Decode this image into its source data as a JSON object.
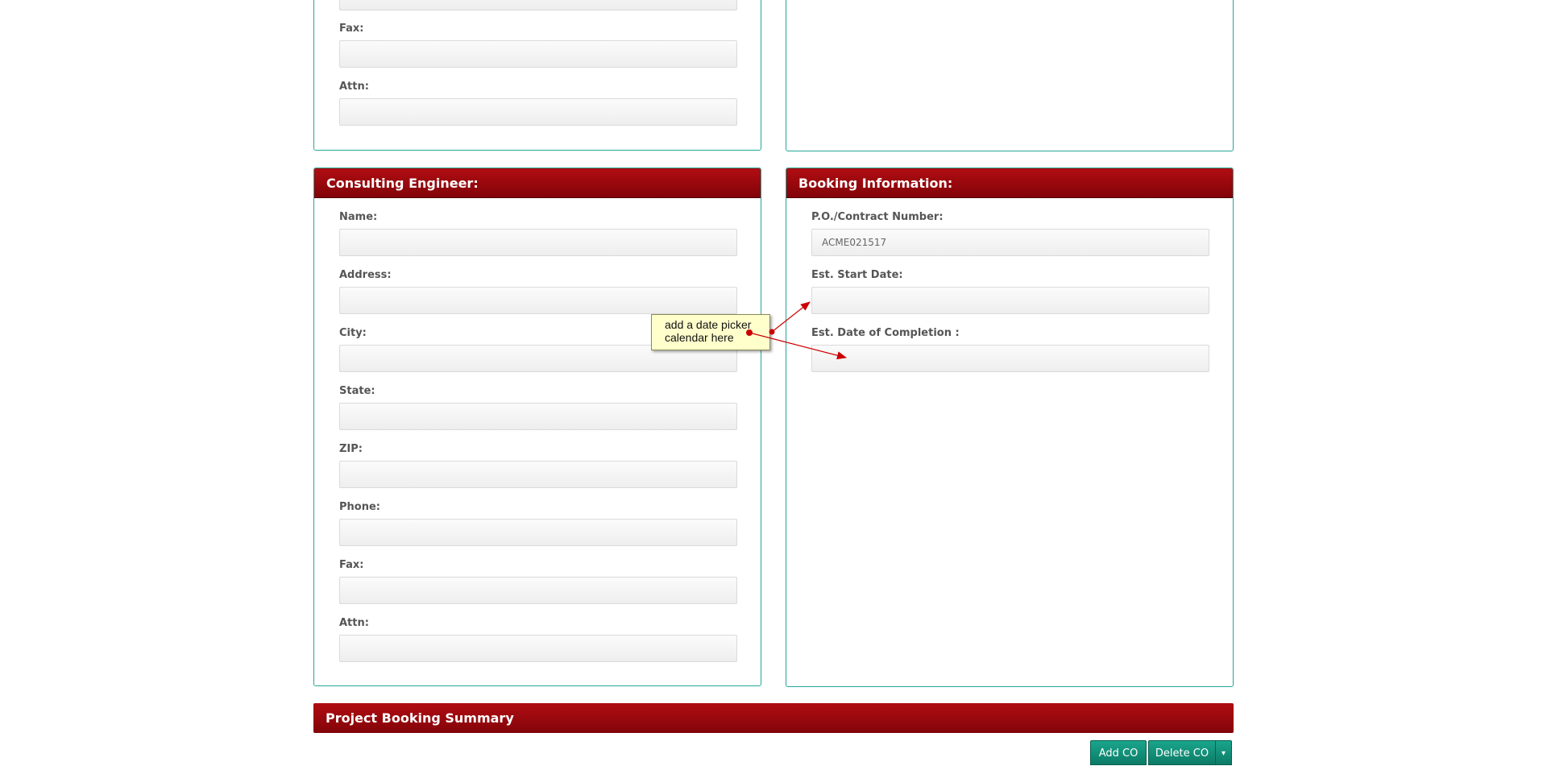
{
  "top_left_panel": {
    "fields": [
      {
        "label": "Fax:",
        "value": ""
      },
      {
        "label": "Attn:",
        "value": ""
      }
    ]
  },
  "consulting_engineer": {
    "title": "Consulting Engineer:",
    "fields": [
      {
        "label": "Name:",
        "value": ""
      },
      {
        "label": "Address:",
        "value": ""
      },
      {
        "label": "City:",
        "value": ""
      },
      {
        "label": "State:",
        "value": ""
      },
      {
        "label": "ZIP:",
        "value": ""
      },
      {
        "label": "Phone:",
        "value": ""
      },
      {
        "label": "Fax:",
        "value": ""
      },
      {
        "label": "Attn:",
        "value": ""
      }
    ]
  },
  "booking_information": {
    "title": "Booking Information:",
    "fields": [
      {
        "label": "P.O./Contract Number:",
        "value": "ACME021517"
      },
      {
        "label": "Est. Start Date:",
        "value": ""
      },
      {
        "label": "Est. Date of Completion :",
        "value": ""
      }
    ]
  },
  "summary": {
    "title": "Project Booking Summary"
  },
  "buttons": {
    "add_co": "Add CO",
    "delete_co": "Delete CO",
    "caret": "▾"
  },
  "annotation": {
    "line1": "add a date picker",
    "line2": "calendar here",
    "color": "#cc0000"
  }
}
